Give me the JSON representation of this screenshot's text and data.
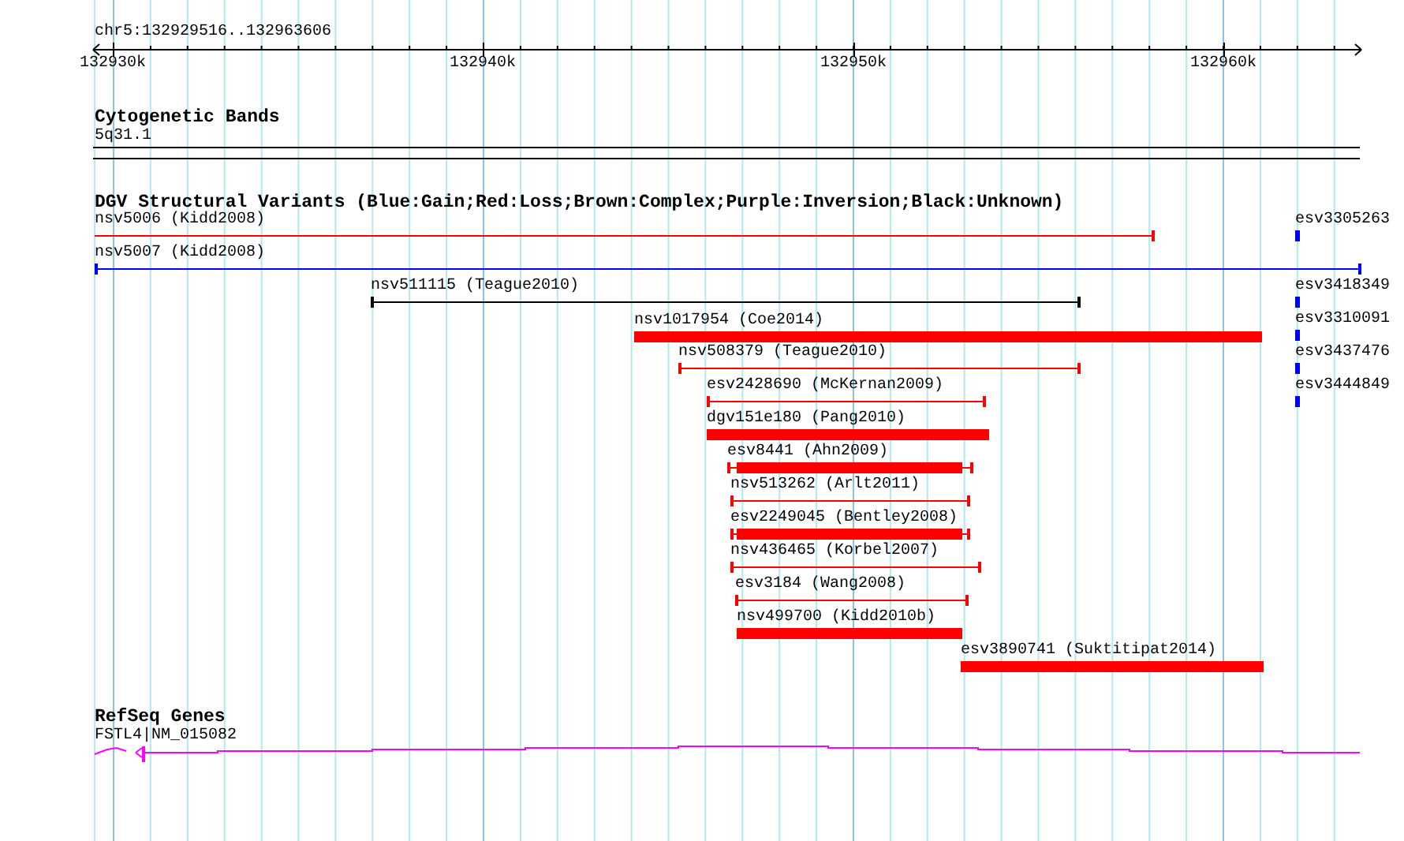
{
  "ruler": {
    "range": "chr5:132929516..132963606",
    "ticks": [
      "132930k",
      "132940k",
      "132950k",
      "132960k"
    ]
  },
  "tracks": [
    {
      "kind": "bands",
      "title": "Cytogenetic Bands",
      "features": [
        {
          "label": "5q31.1",
          "color": "#000000"
        }
      ]
    },
    {
      "kind": "variants",
      "title": "DGV Structural Variants (Blue:Gain;Red:Loss;Brown:Complex;Purple:Inversion;Black:Unknown)",
      "features": [
        {
          "label": "nsv5006 (Kidd2008)",
          "kind": "line",
          "color": "#ff0000"
        },
        {
          "label": "nsv5007 (Kidd2008)",
          "kind": "line",
          "color": "#0000ff"
        },
        {
          "label": "nsv511115 (Teague2010)",
          "kind": "line",
          "color": "#000000"
        },
        {
          "label": "nsv1017954 (Coe2014)",
          "kind": "bar",
          "color": "#ff0000"
        },
        {
          "label": "nsv508379 (Teague2010)",
          "kind": "line",
          "color": "#ff0000"
        },
        {
          "label": "esv2428690 (McKernan2009)",
          "kind": "line",
          "color": "#ff0000"
        },
        {
          "label": "dgv151e180 (Pang2010)",
          "kind": "bar",
          "color": "#ff0000"
        },
        {
          "label": "esv8441 (Ahn2009)",
          "kind": "line_bar",
          "color": "#ff0000"
        },
        {
          "label": "nsv513262 (Arlt2011)",
          "kind": "line",
          "color": "#ff0000"
        },
        {
          "label": "esv2249045 (Bentley2008)",
          "kind": "line_bar",
          "color": "#ff0000"
        },
        {
          "label": "nsv436465 (Korbel2007)",
          "kind": "line",
          "color": "#ff0000"
        },
        {
          "label": "esv3184 (Wang2008)",
          "kind": "line",
          "color": "#ff0000"
        },
        {
          "label": "nsv499700 (Kidd2010b)",
          "kind": "bar",
          "color": "#ff0000"
        },
        {
          "label": "esv3890741 (Suktitipat2014)",
          "kind": "bar",
          "color": "#ff0000"
        },
        {
          "label": "esv3305263",
          "kind": "bar",
          "color": "#0000ff"
        },
        {
          "label": "esv3418349",
          "kind": "bar",
          "color": "#0000ff"
        },
        {
          "label": "esv3310091",
          "kind": "bar",
          "color": "#0000ff"
        },
        {
          "label": "esv3437476",
          "kind": "bar",
          "color": "#0000ff"
        },
        {
          "label": "esv3444849",
          "kind": "bar",
          "color": "#0000ff"
        }
      ]
    },
    {
      "kind": "genes",
      "title": "RefSeq Genes",
      "features": [
        {
          "label": "FSTL4|NM_015082",
          "color": "#ff00ff"
        }
      ]
    }
  ]
}
